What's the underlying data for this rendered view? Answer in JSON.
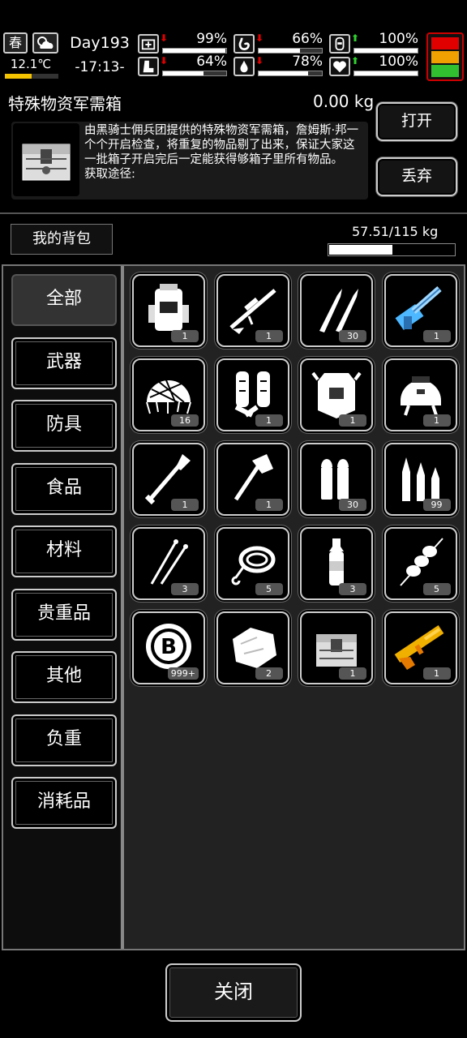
{
  "status": {
    "season": "春",
    "temperature": "12.1℃",
    "temperature_level": 0.5,
    "day": "Day193",
    "time": "-17:13-",
    "stats": [
      {
        "name": "health",
        "icon": "medkit-icon",
        "trend": "down",
        "value": "99%",
        "level": 0.99
      },
      {
        "name": "hunger",
        "icon": "stomach-icon",
        "trend": "down",
        "value": "66%",
        "level": 0.66
      },
      {
        "name": "mood",
        "icon": "toilet-icon",
        "trend": "up",
        "value": "100%",
        "level": 1.0
      },
      {
        "name": "stamina",
        "icon": "boot-icon",
        "trend": "down",
        "value": "64%",
        "level": 0.64
      },
      {
        "name": "thirst",
        "icon": "water-drop-icon",
        "trend": "down",
        "value": "78%",
        "level": 0.78
      },
      {
        "name": "spirit",
        "icon": "heart-icon",
        "trend": "up",
        "value": "100%",
        "level": 1.0
      }
    ],
    "alert_colors": [
      "#e00000",
      "#f0a000",
      "#30c030"
    ]
  },
  "box": {
    "title": "特殊物资军需箱",
    "weight": "0.00 kg",
    "description": "由黑骑士佣兵团提供的特殊物资军需箱，詹姆斯·邦一个个开启检查，将重复的物品剔了出来，保证大家这一批箱子开启完后一定能获得够箱子里所有物品。",
    "source_label": "获取途径:",
    "open_label": "打开",
    "discard_label": "丢弃"
  },
  "backpack": {
    "label": "我的背包",
    "capacity": "57.51/115 kg",
    "capacity_level": 0.5
  },
  "categories": [
    "全部",
    "武器",
    "防具",
    "食品",
    "材料",
    "贵重品",
    "其他",
    "负重",
    "消耗品"
  ],
  "selected_category": "全部",
  "items": [
    {
      "icon": "backpack-icon",
      "count": "1"
    },
    {
      "icon": "sniper-rifle-icon",
      "count": "1"
    },
    {
      "icon": "rifle-bullets-icon",
      "count": "30"
    },
    {
      "icon": "minigun-icon",
      "count": "1"
    },
    {
      "icon": "camo-helmet-net-icon",
      "count": "16"
    },
    {
      "icon": "shin-guards-icon",
      "count": "1"
    },
    {
      "icon": "body-armor-icon",
      "count": "1"
    },
    {
      "icon": "tactical-helmet-icon",
      "count": "1"
    },
    {
      "icon": "shovel-icon",
      "count": "1"
    },
    {
      "icon": "hatchet-icon",
      "count": "1"
    },
    {
      "icon": "pistol-bullets-icon",
      "count": "30"
    },
    {
      "icon": "rifle-cartridges-icon",
      "count": "99"
    },
    {
      "icon": "lockpicks-icon",
      "count": "3"
    },
    {
      "icon": "rope-icon",
      "count": "5"
    },
    {
      "icon": "water-bottle-icon",
      "count": "3"
    },
    {
      "icon": "meat-skewer-icon",
      "count": "5"
    },
    {
      "icon": "bitcoin-icon",
      "count": "999+"
    },
    {
      "icon": "raw-meat-icon",
      "count": "2"
    },
    {
      "icon": "supply-crate-icon",
      "count": "1"
    },
    {
      "icon": "toy-blaster-icon",
      "count": "1"
    }
  ],
  "close_label": "关闭"
}
